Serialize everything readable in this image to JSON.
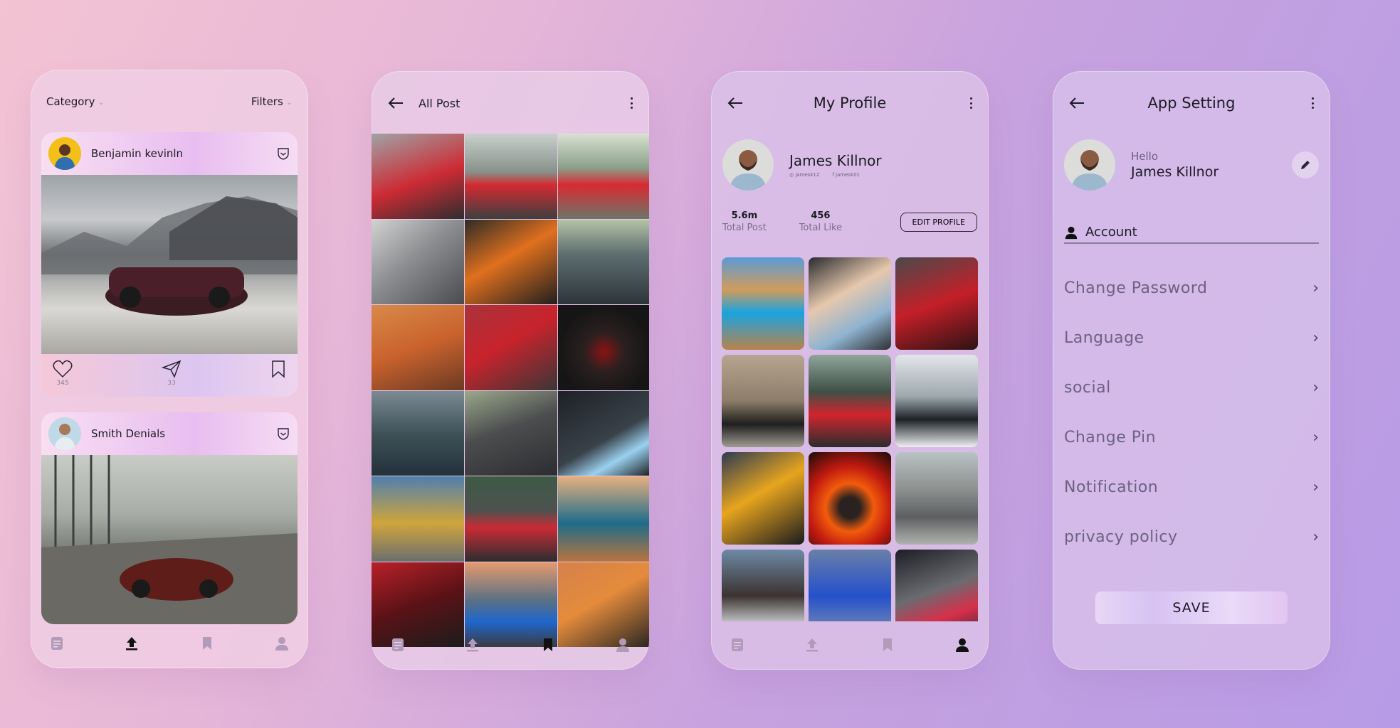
{
  "feed": {
    "category_label": "Category",
    "filters_label": "Filters",
    "posts": [
      {
        "user": "Benjamin kevinln",
        "likes": "345",
        "shares": "33"
      },
      {
        "user": "Smith Denials"
      }
    ]
  },
  "all_post": {
    "title": "All Post"
  },
  "profile": {
    "title": "My Profile",
    "name": "James Killnor",
    "instagram": "jamesk12",
    "facebook": "jamesk01",
    "total_post_value": "5.6m",
    "total_post_label": "Total Post",
    "total_like_value": "456",
    "total_like_label": "Total Like",
    "edit_button": "EDIT PROFILE"
  },
  "settings": {
    "title": "App Setting",
    "greeting": "Hello",
    "name": "James Killnor",
    "section_label": "Account",
    "items": [
      {
        "label": "Change Password"
      },
      {
        "label": "Language"
      },
      {
        "label": "social"
      },
      {
        "label": "Change Pin"
      },
      {
        "label": "Notification"
      },
      {
        "label": "privacy policy"
      }
    ],
    "save_label": "SAVE"
  },
  "icons": {
    "nav": [
      "document-icon",
      "upload-icon",
      "bookmark-icon",
      "user-icon"
    ],
    "feed_active_nav": "upload-icon",
    "all_post_active_nav": "bookmark-icon",
    "profile_active_nav": "user-icon"
  },
  "colors": {
    "background_start": "#f3c3d3",
    "background_end": "#b79be6",
    "nav_active": "#111111",
    "nav_inactive": "#b19bb8"
  }
}
